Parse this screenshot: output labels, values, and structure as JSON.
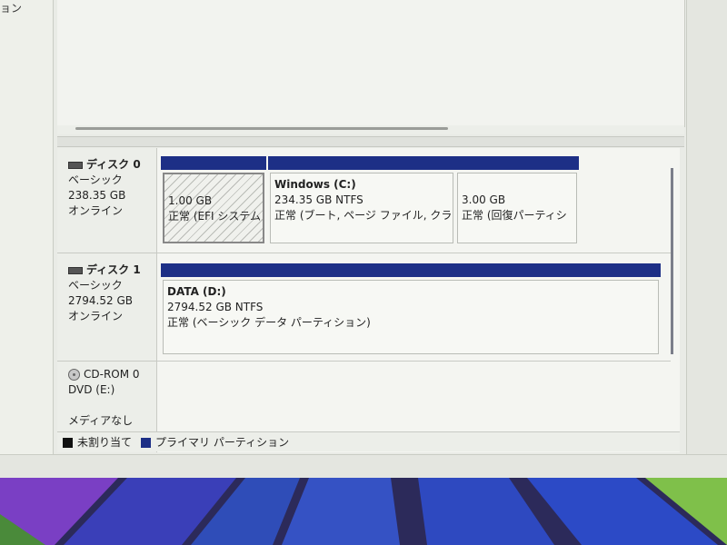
{
  "left_strip": {
    "cut_text": "ョン"
  },
  "disks": [
    {
      "name": "ディスク 0",
      "type": "ベーシック",
      "size": "238.35 GB",
      "status": "オンライン",
      "partitions": [
        {
          "title": "",
          "size": "1.00 GB",
          "desc": "正常 (EFI システム"
        },
        {
          "title": "Windows  (C:)",
          "size": "234.35 GB NTFS",
          "desc": "正常 (ブート, ページ ファイル, クラッシ"
        },
        {
          "title": "",
          "size": "3.00 GB",
          "desc": "正常 (回復パーティシ"
        }
      ]
    },
    {
      "name": "ディスク 1",
      "type": "ベーシック",
      "size": "2794.52 GB",
      "status": "オンライン",
      "partitions": [
        {
          "title": "DATA  (D:)",
          "size": "2794.52 GB NTFS",
          "desc": "正常 (ベーシック データ パーティション)"
        }
      ]
    }
  ],
  "cdrom": {
    "name": "CD-ROM 0",
    "drive": "DVD (E:)",
    "media": "メディアなし"
  },
  "legend": {
    "unallocated": "未割り当て",
    "primary": "プライマリ パーティション"
  },
  "colors": {
    "primary_partition": "#1d2f86",
    "unallocated": "#111111",
    "panel_bg": "#f4f5f1"
  }
}
